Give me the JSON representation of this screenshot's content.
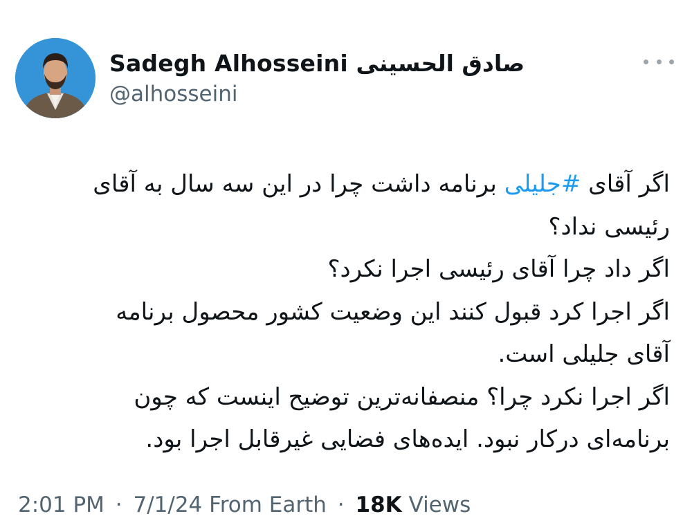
{
  "author": {
    "display_name": "Sadegh Alhosseini صادق الحسینی",
    "handle": "@alhosseini"
  },
  "tweet": {
    "line1_before": "اگر آقای ",
    "hashtag": "#جلیلی",
    "line1_after": " برنامه داشت چرا در این سه سال به آقای",
    "line2": "رئیسی نداد؟",
    "line3": "اگر داد چرا آقای رئیسی اجرا نکرد؟",
    "line4": "اگر اجرا کرد قبول کنند این وضعیت کشور محصول برنامه",
    "line5": "آقای جلیلی است.",
    "line6": "اگر اجرا نکرد چرا؟ منصفانه‌ترین توضیح اینست که چون",
    "line7": "برنامه‌ای درکار نبود. ایده‌های فضایی غیرقابل اجرا بود."
  },
  "meta": {
    "time": "2:01 PM",
    "date": "7/1/24",
    "source": "From Earth",
    "separator": "·",
    "views_count": "18K",
    "views_label": "Views"
  },
  "icons": {
    "more": "more-dots-icon",
    "avatar": "profile-photo"
  },
  "colors": {
    "hashtag": "#1d9bf0",
    "secondary_text": "#536471",
    "primary_text": "#0f1419"
  }
}
